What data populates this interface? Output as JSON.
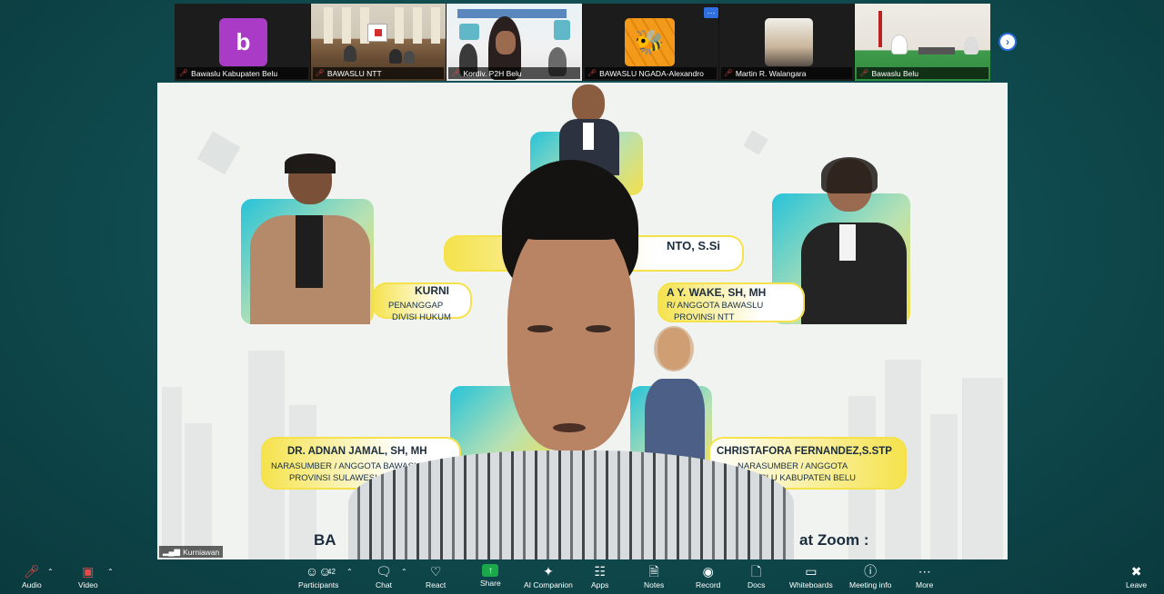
{
  "gallery": {
    "tiles": [
      {
        "name": "Bawaslu Kabupaten Belu",
        "avatar_letter": "b"
      },
      {
        "name": "BAWASLU NTT"
      },
      {
        "name": "Kordiv. P2H Belu"
      },
      {
        "name": "BAWASLU NGADA-Alexandro"
      },
      {
        "name": "Martin R.  Walangara"
      },
      {
        "name": "Bawaslu Belu"
      }
    ],
    "more_label": "⋯",
    "next_label": "›"
  },
  "main_video": {
    "username": "Kurniawan",
    "poster": {
      "top_name": "NTO, S.Si",
      "left_name": "KURNI",
      "left_role_1": "PENANGGAP",
      "left_role_2": "DIVISI HUKUM",
      "right_name": "A Y. WAKE, SH, MH",
      "right_role_1": "R/ ANGGOTA BAWASLU",
      "right_role_2": "PROVINSI NTT",
      "bottom_left_name": "DR. ADNAN JAMAL, SH, MH",
      "bottom_left_role_1": "NARASUMBER / ANGGOTA BAWASLU",
      "bottom_left_role_2": "PROVINSI SULAWESI SELATAN",
      "bottom_right_name": "CHRISTAFORA FERNANDEZ,S.STP",
      "bottom_right_role_1": "NARASUMBER / ANGGOTA",
      "bottom_right_role_2": "BAWASLU KABUPATEN BELU",
      "footer_left": "BA",
      "footer_right": "at Zoom :"
    }
  },
  "toolbar": {
    "audio": "Audio",
    "video": "Video",
    "participants": "Participants",
    "participants_count": "42",
    "chat": "Chat",
    "react": "React",
    "share": "Share",
    "ai_companion": "AI Companion",
    "apps": "Apps",
    "notes": "Notes",
    "record": "Record",
    "docs": "Docs",
    "whiteboards": "Whiteboards",
    "meeting_info": "Meeting info",
    "more": "More",
    "leave": "Leave"
  },
  "colors": {
    "background": "#0f4a4e",
    "share_green": "#1aa84a",
    "accent_blue": "#2f6fe0",
    "mic_off_red": "#e84a4a",
    "poster_yellow": "#f5e24b",
    "poster_cyan": "#27c3d9"
  }
}
